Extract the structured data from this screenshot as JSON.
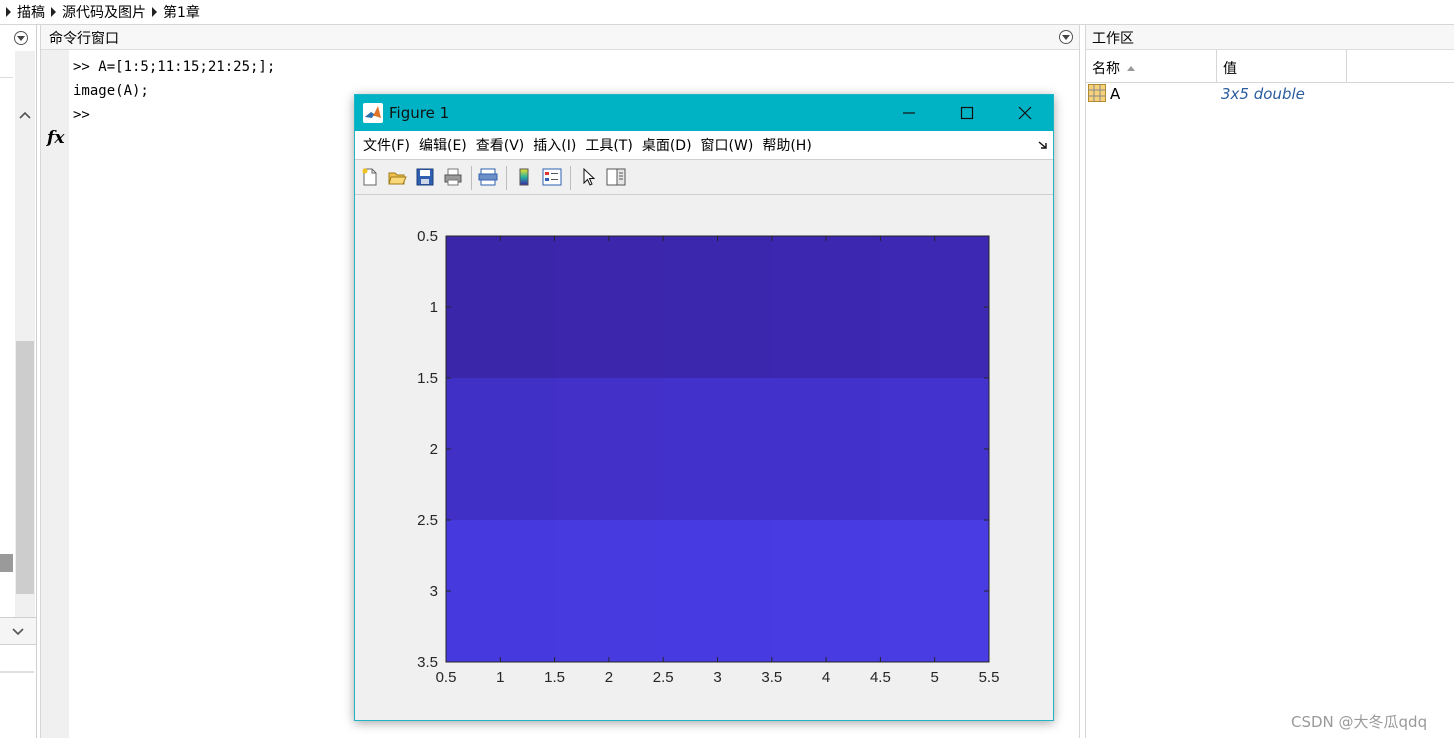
{
  "breadcrumb": [
    "描稿",
    "源代码及图片",
    "第1章"
  ],
  "command_window": {
    "title": "命令行窗口",
    "lines": [
      ">> A=[1:5;11:15;21:25;];",
      "image(A);"
    ],
    "prompt": ">>",
    "fx_label": "fx"
  },
  "workspace": {
    "title": "工作区",
    "col_name": "名称",
    "col_value": "值",
    "variables": [
      {
        "name": "A",
        "value": "3x5 double"
      }
    ]
  },
  "figure": {
    "title": "Figure 1",
    "menu": [
      "文件(F)",
      "编辑(E)",
      "查看(V)",
      "插入(I)",
      "工具(T)",
      "桌面(D)",
      "窗口(W)",
      "帮助(H)"
    ],
    "toolbar_icons": [
      "new-figure-icon",
      "open-file-icon",
      "save-icon",
      "print-icon",
      "print-preview-icon",
      "colorbar-icon",
      "legend-icon",
      "pointer-icon",
      "property-editor-icon"
    ]
  },
  "chart_data": {
    "type": "heatmap",
    "x_ticks": [
      "0.5",
      "1",
      "1.5",
      "2",
      "2.5",
      "3",
      "3.5",
      "4",
      "4.5",
      "5",
      "5.5"
    ],
    "y_ticks": [
      "0.5",
      "1",
      "1.5",
      "2",
      "2.5",
      "3",
      "3.5"
    ],
    "xlim": [
      0.5,
      5.5
    ],
    "ylim": [
      0.5,
      3.5
    ],
    "y_reversed": true,
    "rows": [
      {
        "values": [
          1,
          2,
          3,
          4,
          5
        ],
        "colors": [
          "#3A26A9",
          "#3B26AC",
          "#3B27AE",
          "#3B27B0",
          "#3C28B2"
        ]
      },
      {
        "values": [
          11,
          12,
          13,
          14,
          15
        ],
        "colors": [
          "#4130C6",
          "#4230C8",
          "#4231CA",
          "#4231CB",
          "#4332CD"
        ]
      },
      {
        "values": [
          21,
          22,
          23,
          24,
          25
        ],
        "colors": [
          "#4639DE",
          "#473ADF",
          "#473AE0",
          "#473BE1",
          "#483CE2"
        ]
      }
    ]
  },
  "watermark": "CSDN @大冬瓜qdq"
}
